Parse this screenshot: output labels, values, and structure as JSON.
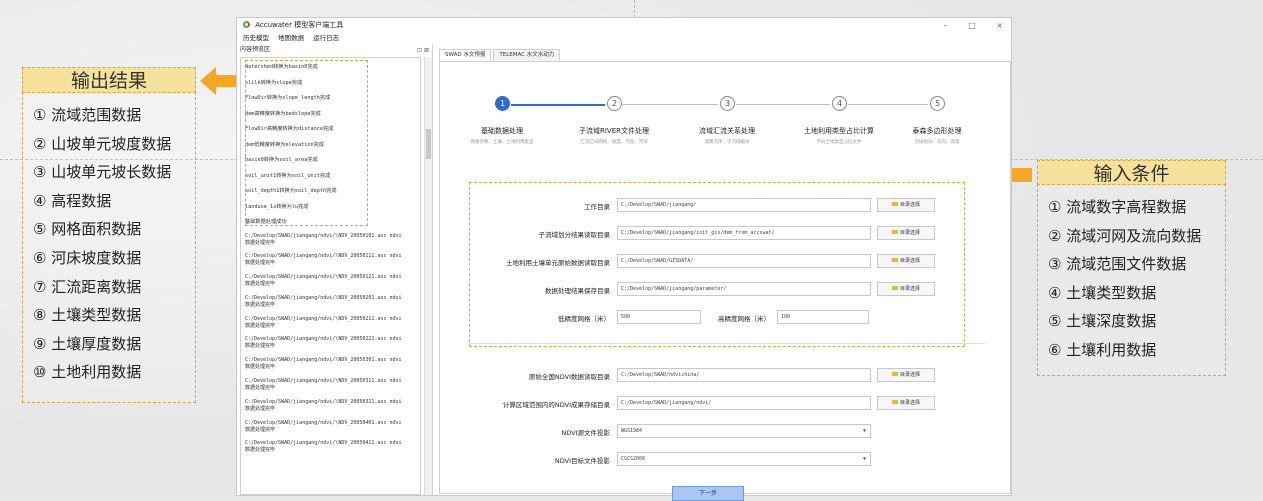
{
  "app": {
    "title": "Accuwater 模型客户端工具",
    "window_controls": [
      "–",
      "□",
      "×"
    ],
    "menu": [
      "历史模型",
      "地图数据",
      "运行日志"
    ]
  },
  "left_pane": {
    "header": "内容预览区",
    "header_icons": "⊡ ⊠",
    "log_lines": [
      "Watershed转换为basin0完成",
      "slilk转换为slope完成",
      "FlowDir转换为slope_length完成",
      "dem高精度转换为bedslope完成",
      "FlowDir高精度转换为distance完成",
      "dem低精度转换为elevation完成",
      "basin0转换为soil_area完成",
      "soil_unit1转换为soil_unit完成",
      "soil_depth1转换为soil_depth完成",
      "landuse_1s转换为lu完成",
      "基础数据处理成功"
    ],
    "entries": [
      {
        "path": "C:/Develop/SWAD/jiangang/ndvi/\\NDV_20050101.asc ndvi",
        "status": "数据处理完毕"
      },
      {
        "path": "C:/Develop/SWAD/jiangang/ndvi/\\NDV_20050111.asc ndvi",
        "status": "数据处理完毕"
      },
      {
        "path": "C:/Develop/SWAD/jiangang/ndvi/\\NDV_20050121.asc ndvi",
        "status": "数据处理完毕"
      },
      {
        "path": "C:/Develop/SWAD/jiangang/ndvi/\\NDV_20050201.asc ndvi",
        "status": "数据处理完毕"
      },
      {
        "path": "C:/Develop/SWAD/jiangang/ndvi/\\NDV_20050211.asc ndvi",
        "status": "数据处理完毕"
      },
      {
        "path": "C:/Develop/SWAD/jiangang/ndvi/\\NDV_20050221.asc ndvi",
        "status": "数据处理完毕"
      },
      {
        "path": "C:/Develop/SWAD/jiangang/ndvi/\\NDV_20050301.asc ndvi",
        "status": "数据处理完毕"
      },
      {
        "path": "C:/Develop/SWAD/jiangang/ndvi/\\NDV_20050311.asc ndvi",
        "status": "数据处理完毕"
      },
      {
        "path": "C:/Develop/SWAD/jiangang/ndvi/\\NDV_20050321.asc ndvi",
        "status": "数据处理完毕"
      },
      {
        "path": "C:/Develop/SWAD/jiangang/ndvi/\\NDV_20050401.asc ndvi",
        "status": "数据处理完毕"
      },
      {
        "path": "C:/Develop/SWAD/jiangang/ndvi/\\NDV_20050411.asc ndvi",
        "status": "数据处理完毕"
      }
    ]
  },
  "tabs": [
    "SWAD 水文预报",
    "TELEMAC 水文水动力"
  ],
  "steps": [
    {
      "num": "1",
      "label": "基础数据处理",
      "sub": "网格参数、土壤、土地利用类型"
    },
    {
      "num": "2",
      "label": "子流域RIVER文件处理",
      "sub": "汇流区间网格、坡度、河宽、河深"
    },
    {
      "num": "3",
      "label": "流域汇流关系处理",
      "sub": "演算次序、子流域编号"
    },
    {
      "num": "4",
      "label": "土地利用类型占比计算",
      "sub": "不同土地类型占比文件"
    },
    {
      "num": "5",
      "label": "泰森多边形处理",
      "sub": "流域划分、流向、高程"
    }
  ],
  "form": {
    "fields": [
      {
        "label": "工作目录",
        "value": "C:/Develop/SWAD/jiangang/"
      },
      {
        "label": "子流域划分结果读取目录",
        "value": "C:/Develop/SWAD/jiangang/init_gis/dem_from_arcswat/"
      },
      {
        "label": "土地利用土壤单元原始数据读取目录",
        "value": "C:/Develop/SWAD/GISDATA/"
      },
      {
        "label": "数据处理结果保存目录",
        "value": "C:/Develop/SWAD/jiangang/parameter/"
      }
    ],
    "dir_button": "目录选择",
    "low_res_label": "低精度网格（米）",
    "low_res_value": "500",
    "high_res_label": "高精度网格（米）",
    "high_res_value": "100",
    "ndvi_fields": [
      {
        "label": "原始全国NDVI数据读取目录",
        "value": "C:/Develop/SWAD/ndvichina/"
      },
      {
        "label": "计算区域范围内的NDVI成果存储目录",
        "value": "C:/Develop/SWAD/jiangang/ndvi/"
      }
    ],
    "src_proj_label": "NDVI源文件投影",
    "src_proj_value": "WGS1984",
    "dst_proj_label": "NDVI目标文件投影",
    "dst_proj_value": "CGCS2000",
    "next_button": "下一步"
  },
  "output_panel": {
    "title": "输出结果",
    "items": [
      "① 流域范围数据",
      "② 山坡单元坡度数据",
      "③ 山坡单元坡长数据",
      "④ 高程数据",
      "⑤ 网格面积数据",
      "⑥ 河床坡度数据",
      "⑦ 汇流距离数据",
      "⑧ 土壤类型数据",
      "⑨ 土壤厚度数据",
      "⑩ 土地利用数据"
    ]
  },
  "input_panel": {
    "title": "输入条件",
    "items": [
      "① 流域数字高程数据",
      "② 流域河网及流向数据",
      "③ 流域范围文件数据",
      "④ 土壤类型数据",
      "⑤ 土壤深度数据",
      "⑥ 土壤利用数据"
    ]
  },
  "colors": {
    "accent": "#2f6ad9",
    "highlight": "#f5a623",
    "panel_title": "#f6e29a"
  }
}
